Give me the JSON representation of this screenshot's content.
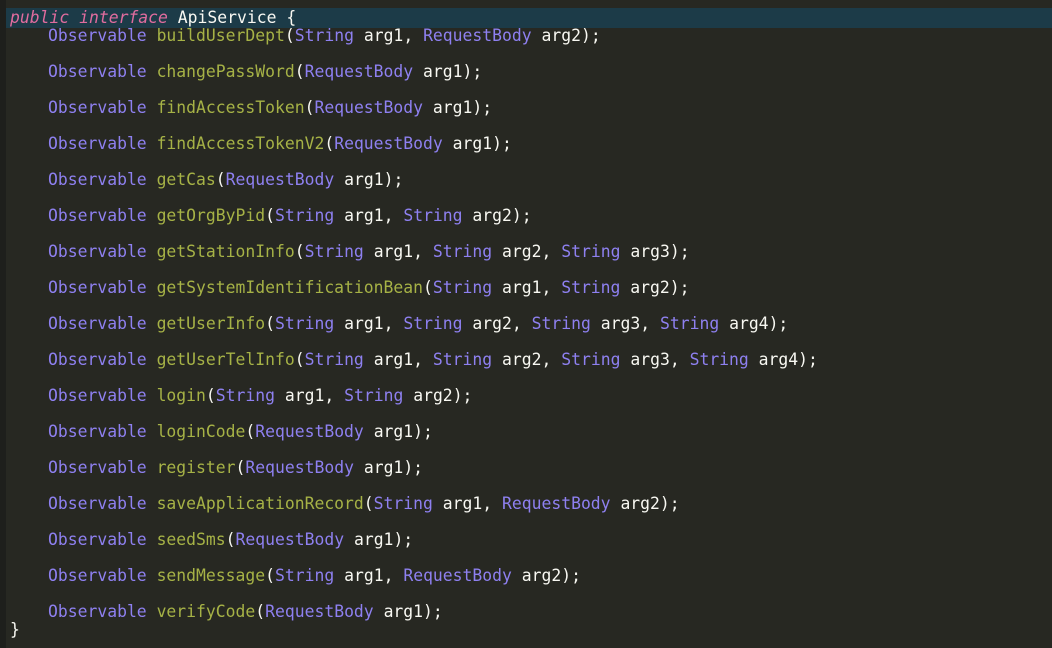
{
  "header": {
    "kw_public": "public",
    "kw_interface": "interface",
    "name": "ApiService",
    "open": " {"
  },
  "return_type": "Observable",
  "methods": [
    {
      "name": "buildUserDept",
      "params": [
        {
          "type": "String",
          "name": "arg1"
        },
        {
          "type": "RequestBody",
          "name": "arg2"
        }
      ]
    },
    {
      "name": "changePassWord",
      "params": [
        {
          "type": "RequestBody",
          "name": "arg1"
        }
      ]
    },
    {
      "name": "findAccessToken",
      "params": [
        {
          "type": "RequestBody",
          "name": "arg1"
        }
      ]
    },
    {
      "name": "findAccessTokenV2",
      "params": [
        {
          "type": "RequestBody",
          "name": "arg1"
        }
      ]
    },
    {
      "name": "getCas",
      "params": [
        {
          "type": "RequestBody",
          "name": "arg1"
        }
      ]
    },
    {
      "name": "getOrgByPid",
      "params": [
        {
          "type": "String",
          "name": "arg1"
        },
        {
          "type": "String",
          "name": "arg2"
        }
      ]
    },
    {
      "name": "getStationInfo",
      "params": [
        {
          "type": "String",
          "name": "arg1"
        },
        {
          "type": "String",
          "name": "arg2"
        },
        {
          "type": "String",
          "name": "arg3"
        }
      ]
    },
    {
      "name": "getSystemIdentificationBean",
      "params": [
        {
          "type": "String",
          "name": "arg1"
        },
        {
          "type": "String",
          "name": "arg2"
        }
      ]
    },
    {
      "name": "getUserInfo",
      "params": [
        {
          "type": "String",
          "name": "arg1"
        },
        {
          "type": "String",
          "name": "arg2"
        },
        {
          "type": "String",
          "name": "arg3"
        },
        {
          "type": "String",
          "name": "arg4"
        }
      ]
    },
    {
      "name": "getUserTelInfo",
      "params": [
        {
          "type": "String",
          "name": "arg1"
        },
        {
          "type": "String",
          "name": "arg2"
        },
        {
          "type": "String",
          "name": "arg3"
        },
        {
          "type": "String",
          "name": "arg4"
        }
      ]
    },
    {
      "name": "login",
      "params": [
        {
          "type": "String",
          "name": "arg1"
        },
        {
          "type": "String",
          "name": "arg2"
        }
      ]
    },
    {
      "name": "loginCode",
      "params": [
        {
          "type": "RequestBody",
          "name": "arg1"
        }
      ]
    },
    {
      "name": "register",
      "params": [
        {
          "type": "RequestBody",
          "name": "arg1"
        }
      ]
    },
    {
      "name": "saveApplicationRecord",
      "params": [
        {
          "type": "String",
          "name": "arg1"
        },
        {
          "type": "RequestBody",
          "name": "arg2"
        }
      ]
    },
    {
      "name": "seedSms",
      "params": [
        {
          "type": "RequestBody",
          "name": "arg1"
        }
      ]
    },
    {
      "name": "sendMessage",
      "params": [
        {
          "type": "String",
          "name": "arg1"
        },
        {
          "type": "RequestBody",
          "name": "arg2"
        }
      ]
    },
    {
      "name": "verifyCode",
      "params": [
        {
          "type": "RequestBody",
          "name": "arg1"
        }
      ]
    }
  ],
  "footer": {
    "close": "}"
  },
  "colors": {
    "background": "#272822",
    "current_line": "#1c3b48",
    "keyword": "#e06c9e",
    "type": "#8e80f0",
    "method": "#a6b246",
    "text": "#f8f8f2"
  }
}
